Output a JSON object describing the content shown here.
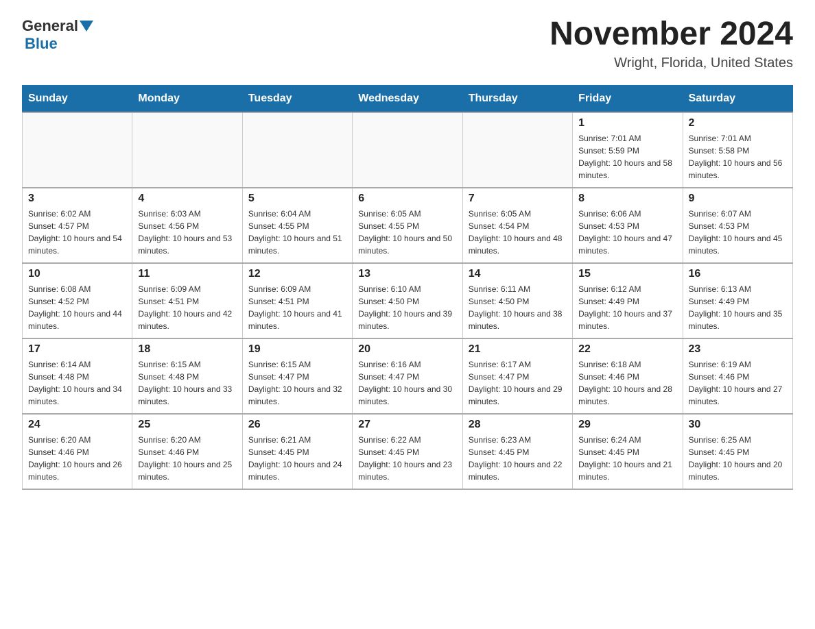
{
  "header": {
    "logo_general": "General",
    "logo_blue": "Blue",
    "month_title": "November 2024",
    "location": "Wright, Florida, United States"
  },
  "weekdays": [
    "Sunday",
    "Monday",
    "Tuesday",
    "Wednesday",
    "Thursday",
    "Friday",
    "Saturday"
  ],
  "weeks": [
    [
      {
        "day": "",
        "info": ""
      },
      {
        "day": "",
        "info": ""
      },
      {
        "day": "",
        "info": ""
      },
      {
        "day": "",
        "info": ""
      },
      {
        "day": "",
        "info": ""
      },
      {
        "day": "1",
        "info": "Sunrise: 7:01 AM\nSunset: 5:59 PM\nDaylight: 10 hours and 58 minutes."
      },
      {
        "day": "2",
        "info": "Sunrise: 7:01 AM\nSunset: 5:58 PM\nDaylight: 10 hours and 56 minutes."
      }
    ],
    [
      {
        "day": "3",
        "info": "Sunrise: 6:02 AM\nSunset: 4:57 PM\nDaylight: 10 hours and 54 minutes."
      },
      {
        "day": "4",
        "info": "Sunrise: 6:03 AM\nSunset: 4:56 PM\nDaylight: 10 hours and 53 minutes."
      },
      {
        "day": "5",
        "info": "Sunrise: 6:04 AM\nSunset: 4:55 PM\nDaylight: 10 hours and 51 minutes."
      },
      {
        "day": "6",
        "info": "Sunrise: 6:05 AM\nSunset: 4:55 PM\nDaylight: 10 hours and 50 minutes."
      },
      {
        "day": "7",
        "info": "Sunrise: 6:05 AM\nSunset: 4:54 PM\nDaylight: 10 hours and 48 minutes."
      },
      {
        "day": "8",
        "info": "Sunrise: 6:06 AM\nSunset: 4:53 PM\nDaylight: 10 hours and 47 minutes."
      },
      {
        "day": "9",
        "info": "Sunrise: 6:07 AM\nSunset: 4:53 PM\nDaylight: 10 hours and 45 minutes."
      }
    ],
    [
      {
        "day": "10",
        "info": "Sunrise: 6:08 AM\nSunset: 4:52 PM\nDaylight: 10 hours and 44 minutes."
      },
      {
        "day": "11",
        "info": "Sunrise: 6:09 AM\nSunset: 4:51 PM\nDaylight: 10 hours and 42 minutes."
      },
      {
        "day": "12",
        "info": "Sunrise: 6:09 AM\nSunset: 4:51 PM\nDaylight: 10 hours and 41 minutes."
      },
      {
        "day": "13",
        "info": "Sunrise: 6:10 AM\nSunset: 4:50 PM\nDaylight: 10 hours and 39 minutes."
      },
      {
        "day": "14",
        "info": "Sunrise: 6:11 AM\nSunset: 4:50 PM\nDaylight: 10 hours and 38 minutes."
      },
      {
        "day": "15",
        "info": "Sunrise: 6:12 AM\nSunset: 4:49 PM\nDaylight: 10 hours and 37 minutes."
      },
      {
        "day": "16",
        "info": "Sunrise: 6:13 AM\nSunset: 4:49 PM\nDaylight: 10 hours and 35 minutes."
      }
    ],
    [
      {
        "day": "17",
        "info": "Sunrise: 6:14 AM\nSunset: 4:48 PM\nDaylight: 10 hours and 34 minutes."
      },
      {
        "day": "18",
        "info": "Sunrise: 6:15 AM\nSunset: 4:48 PM\nDaylight: 10 hours and 33 minutes."
      },
      {
        "day": "19",
        "info": "Sunrise: 6:15 AM\nSunset: 4:47 PM\nDaylight: 10 hours and 32 minutes."
      },
      {
        "day": "20",
        "info": "Sunrise: 6:16 AM\nSunset: 4:47 PM\nDaylight: 10 hours and 30 minutes."
      },
      {
        "day": "21",
        "info": "Sunrise: 6:17 AM\nSunset: 4:47 PM\nDaylight: 10 hours and 29 minutes."
      },
      {
        "day": "22",
        "info": "Sunrise: 6:18 AM\nSunset: 4:46 PM\nDaylight: 10 hours and 28 minutes."
      },
      {
        "day": "23",
        "info": "Sunrise: 6:19 AM\nSunset: 4:46 PM\nDaylight: 10 hours and 27 minutes."
      }
    ],
    [
      {
        "day": "24",
        "info": "Sunrise: 6:20 AM\nSunset: 4:46 PM\nDaylight: 10 hours and 26 minutes."
      },
      {
        "day": "25",
        "info": "Sunrise: 6:20 AM\nSunset: 4:46 PM\nDaylight: 10 hours and 25 minutes."
      },
      {
        "day": "26",
        "info": "Sunrise: 6:21 AM\nSunset: 4:45 PM\nDaylight: 10 hours and 24 minutes."
      },
      {
        "day": "27",
        "info": "Sunrise: 6:22 AM\nSunset: 4:45 PM\nDaylight: 10 hours and 23 minutes."
      },
      {
        "day": "28",
        "info": "Sunrise: 6:23 AM\nSunset: 4:45 PM\nDaylight: 10 hours and 22 minutes."
      },
      {
        "day": "29",
        "info": "Sunrise: 6:24 AM\nSunset: 4:45 PM\nDaylight: 10 hours and 21 minutes."
      },
      {
        "day": "30",
        "info": "Sunrise: 6:25 AM\nSunset: 4:45 PM\nDaylight: 10 hours and 20 minutes."
      }
    ]
  ]
}
